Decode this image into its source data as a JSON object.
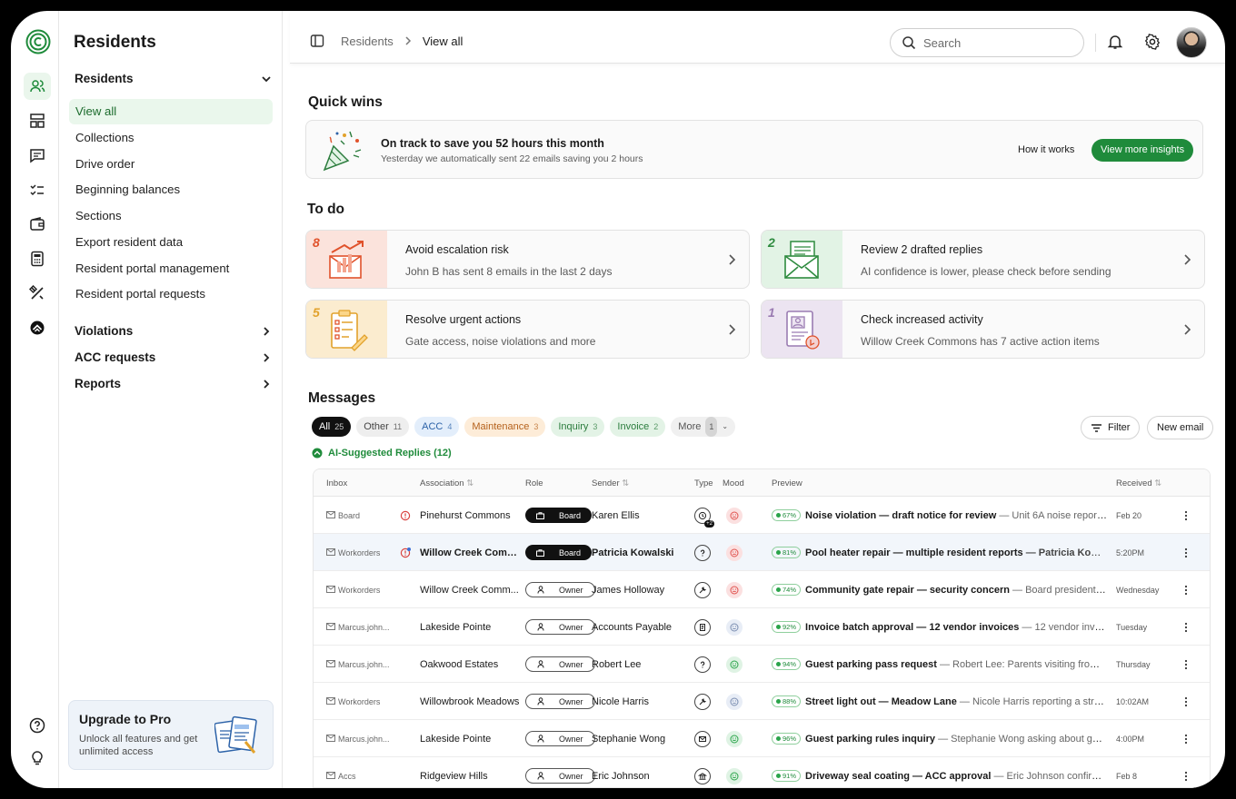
{
  "app": {
    "title": "Residents"
  },
  "breadcrumb": {
    "parent": "Residents",
    "current": "View all"
  },
  "search": {
    "placeholder": "Search"
  },
  "sidebar": {
    "groups": {
      "residents": "Residents",
      "violations": "Violations",
      "acc": "ACC requests",
      "reports": "Reports"
    },
    "items": [
      "View all",
      "Collections",
      "Drive order",
      "Beginning balances",
      "Sections",
      "Export resident data",
      "Resident portal management",
      "Resident portal requests"
    ],
    "upgrade": {
      "title": "Upgrade to Pro",
      "desc": "Unlock all features and get unlimited access"
    }
  },
  "quick_wins": {
    "heading": "Quick wins",
    "title": "On track to save you 52 hours this month",
    "desc": "Yesterday we automatically sent 22 emails saving you 2 hours",
    "how": "How it works",
    "button": "View more insights"
  },
  "todo": {
    "heading": "To do",
    "cards": [
      {
        "num": "8",
        "title": "Avoid escalation risk",
        "desc": "John B has sent 8 emails in the last 2 days",
        "bg": "#fbe3dc",
        "color": "#e0522b"
      },
      {
        "num": "2",
        "title": "Review 2 drafted replies",
        "desc": "AI confidence is lower, please check before sending",
        "bg": "#e2f3e5",
        "color": "#2e8b3f"
      },
      {
        "num": "5",
        "title": "Resolve urgent actions",
        "desc": "Gate access, noise violations and more",
        "bg": "#fbeccf",
        "color": "#e2a22c"
      },
      {
        "num": "1",
        "title": "Check increased activity",
        "desc": "Willow Creek Commons has 7 active action items",
        "bg": "#ece4f1",
        "color": "#9a7bb2"
      }
    ]
  },
  "messages": {
    "heading": "Messages",
    "chips": [
      {
        "label": "All",
        "count": "25",
        "bg": "#111111",
        "fg": "#ffffff"
      },
      {
        "label": "Other",
        "count": "11",
        "bg": "#eeeeee",
        "fg": "#444444"
      },
      {
        "label": "ACC",
        "count": "4",
        "bg": "#e3eefb",
        "fg": "#2c62a8"
      },
      {
        "label": "Maintenance",
        "count": "3",
        "bg": "#fdecd8",
        "fg": "#b5611c"
      },
      {
        "label": "Inquiry",
        "count": "3",
        "bg": "#e3f3e6",
        "fg": "#2b7c3d"
      },
      {
        "label": "Invoice",
        "count": "2",
        "bg": "#e3f3e6",
        "fg": "#2b7c3d"
      },
      {
        "label": "More",
        "count": "1",
        "bg": "#f0f0f0",
        "fg": "#555555"
      }
    ],
    "filter": "Filter",
    "new_email": "New email",
    "ai_label": "AI-Suggested Replies (12)",
    "columns": {
      "inbox": "Inbox",
      "association": "Association",
      "role": "Role",
      "sender": "Sender",
      "type": "Type",
      "mood": "Mood",
      "preview": "Preview",
      "received": "Received"
    },
    "rows": [
      {
        "inbox": "Board",
        "alert": "red",
        "association": "Pinehurst Commons",
        "role": "Board",
        "sender": "Karen Ellis",
        "type": "clock",
        "type_badge": "+2",
        "mood": "bad",
        "pct": "67%",
        "subject": "Noise violation — draft notice for review",
        "rest": " — Unit 6A noise reports fr...",
        "received": "Feb 20",
        "bold": false
      },
      {
        "inbox": "Workorders",
        "alert": "red-dot",
        "association": "Willow Creek Comm...",
        "role": "Board",
        "sender": "Patricia Kowalski",
        "type": "question",
        "type_badge": "",
        "mood": "bad",
        "pct": "81%",
        "subject": "Pool heater repair — multiple resident reports",
        "rest": " — Patricia Kowal...",
        "received": "5:20PM",
        "bold": true
      },
      {
        "inbox": "Workorders",
        "alert": "",
        "association": "Willow Creek Comm...",
        "role": "Owner",
        "sender": "James Holloway",
        "type": "wrench",
        "type_badge": "",
        "mood": "bad",
        "pct": "74%",
        "subject": "Community gate repair — security concern",
        "rest": " — Board president: Mai...",
        "received": "Wednesday",
        "bold": false
      },
      {
        "inbox": "Marcus.john...",
        "alert": "",
        "association": "Lakeside Pointe",
        "role": "Owner",
        "sender": "Accounts Payable",
        "type": "invoice",
        "type_badge": "",
        "mood": "neutral",
        "pct": "92%",
        "subject": "Invoice batch approval — 12 vendor invoices",
        "rest": " — 12 vendor invoices ...",
        "received": "Tuesday",
        "bold": false
      },
      {
        "inbox": "Marcus.john...",
        "alert": "",
        "association": "Oakwood Estates",
        "role": "Owner",
        "sender": "Robert Lee",
        "type": "question",
        "type_badge": "",
        "mood": "good",
        "pct": "94%",
        "subject": "Guest parking pass request",
        "rest": " — Robert Lee: Parents visiting from out ...",
        "received": "Thursday",
        "bold": false
      },
      {
        "inbox": "Workorders",
        "alert": "",
        "association": "Willowbrook Meadows",
        "role": "Owner",
        "sender": "Nicole Harris",
        "type": "wrench",
        "type_badge": "",
        "mood": "neutral",
        "pct": "88%",
        "subject": "Street light out — Meadow Lane",
        "rest": " — Nicole Harris reporting a street li...",
        "received": "10:02AM",
        "bold": false
      },
      {
        "inbox": "Marcus.john...",
        "alert": "",
        "association": "Lakeside Pointe",
        "role": "Owner",
        "sender": "Stephanie Wong",
        "type": "mail",
        "type_badge": "",
        "mood": "good",
        "pct": "96%",
        "subject": "Guest parking rules inquiry",
        "rest": " — Stephanie Wong asking about guest p...",
        "received": "4:00PM",
        "bold": false
      },
      {
        "inbox": "Accs",
        "alert": "",
        "association": "Ridgeview Hills",
        "role": "Owner",
        "sender": "Eric Johnson",
        "type": "bank",
        "type_badge": "",
        "mood": "good",
        "pct": "91%",
        "subject": "Driveway seal coating — ACC approval",
        "rest": " — Eric Johnson confirming r...",
        "received": "Feb 8",
        "bold": false
      }
    ]
  }
}
